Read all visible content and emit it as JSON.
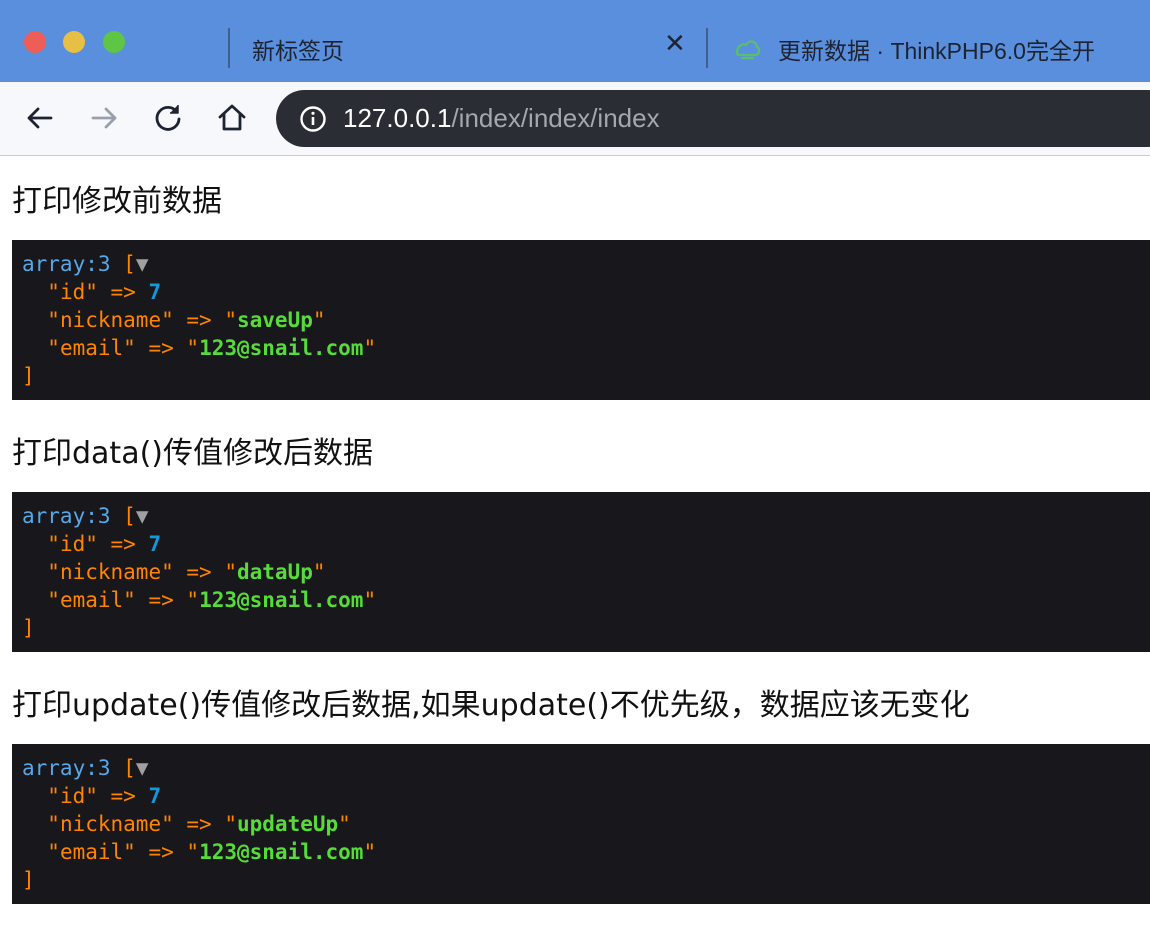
{
  "browser": {
    "tabs": [
      {
        "title": "新标签页",
        "close": "✕"
      },
      {
        "title": "更新数据 · ThinkPHP6.0完全开",
        "close": "✕"
      }
    ],
    "url_host": "127.0.0.1",
    "url_path": "/index/index/index"
  },
  "sections": [
    {
      "heading": "打印修改前数据",
      "dump": {
        "header": "array:3",
        "open": "[",
        "toggle": "▼",
        "close": "]",
        "rows": [
          {
            "key": "\"id\"",
            "arrow": "=>",
            "value": "7",
            "kind": "num"
          },
          {
            "key": "\"nickname\"",
            "arrow": "=>",
            "value_q1": "\"",
            "value": "saveUp",
            "value_q2": "\"",
            "kind": "str"
          },
          {
            "key": "\"email\"",
            "arrow": "=>",
            "value_q1": "\"",
            "value": "123@snail.com",
            "value_q2": "\"",
            "kind": "str"
          }
        ]
      }
    },
    {
      "heading": "打印data()传值修改后数据",
      "dump": {
        "header": "array:3",
        "open": "[",
        "toggle": "▼",
        "close": "]",
        "rows": [
          {
            "key": "\"id\"",
            "arrow": "=>",
            "value": "7",
            "kind": "num"
          },
          {
            "key": "\"nickname\"",
            "arrow": "=>",
            "value_q1": "\"",
            "value": "dataUp",
            "value_q2": "\"",
            "kind": "str"
          },
          {
            "key": "\"email\"",
            "arrow": "=>",
            "value_q1": "\"",
            "value": "123@snail.com",
            "value_q2": "\"",
            "kind": "str"
          }
        ]
      }
    },
    {
      "heading": "打印update()传值修改后数据,如果update()不优先级，数据应该无变化",
      "dump": {
        "header": "array:3",
        "open": "[",
        "toggle": "▼",
        "close": "]",
        "rows": [
          {
            "key": "\"id\"",
            "arrow": "=>",
            "value": "7",
            "kind": "num"
          },
          {
            "key": "\"nickname\"",
            "arrow": "=>",
            "value_q1": "\"",
            "value": "updateUp",
            "value_q2": "\"",
            "kind": "str"
          },
          {
            "key": "\"email\"",
            "arrow": "=>",
            "value_q1": "\"",
            "value": "123@snail.com",
            "value_q2": "\"",
            "kind": "str"
          }
        ]
      }
    }
  ],
  "colors": {
    "tabstrip": "#5a8fde",
    "dump_bg": "#18171b",
    "dump_type": "#56a8e8",
    "dump_key": "#ff8400",
    "dump_num": "#1299da",
    "dump_str": "#56db3a"
  },
  "icons": [
    "back-arrow-icon",
    "forward-arrow-icon",
    "reload-icon",
    "home-icon",
    "info-icon",
    "tab-favicon",
    "close-icon"
  ]
}
